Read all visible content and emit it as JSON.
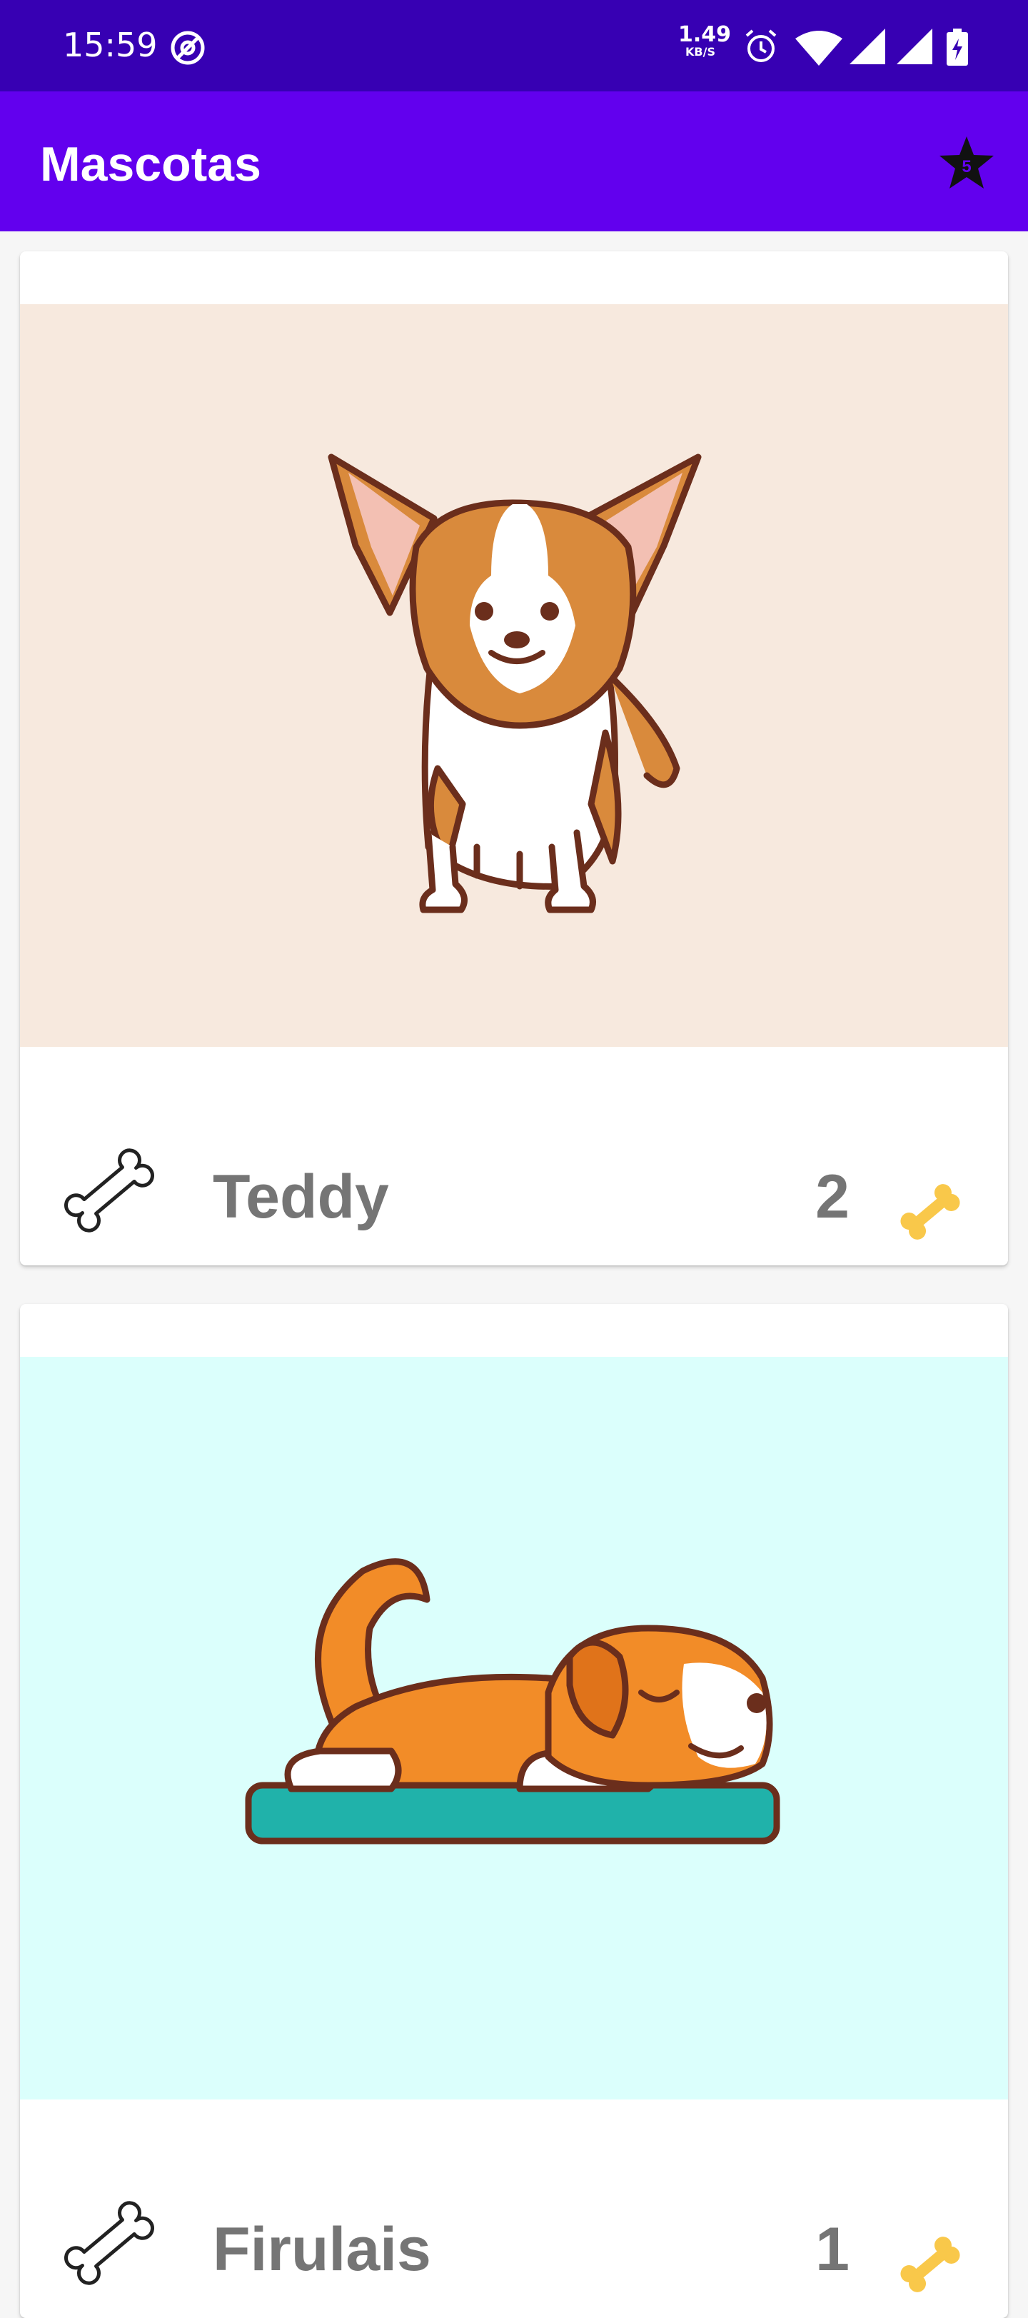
{
  "status_bar": {
    "time": "15:59",
    "network_speed": "1.49",
    "network_speed_unit": "KB/S",
    "icons": [
      "sync-icon",
      "alarm-icon",
      "wifi-icon",
      "signal-icon",
      "signal-icon",
      "battery-charging-icon"
    ]
  },
  "app_bar": {
    "title": "Mascotas",
    "action_icon": "favorites-star-icon",
    "action_badge": "5"
  },
  "pets": [
    {
      "name": "Teddy",
      "likes": "2",
      "image": "corgi-illustration",
      "image_bg": "#f7e9de"
    },
    {
      "name": "Firulais",
      "likes": "1",
      "image": "sleeping-dog-illustration",
      "image_bg": "#dbfffc"
    }
  ],
  "colors": {
    "status_bar": "#3700b3",
    "app_bar": "#6200ee",
    "text_secondary": "#757575",
    "bone_gold": "#f9c84a"
  }
}
